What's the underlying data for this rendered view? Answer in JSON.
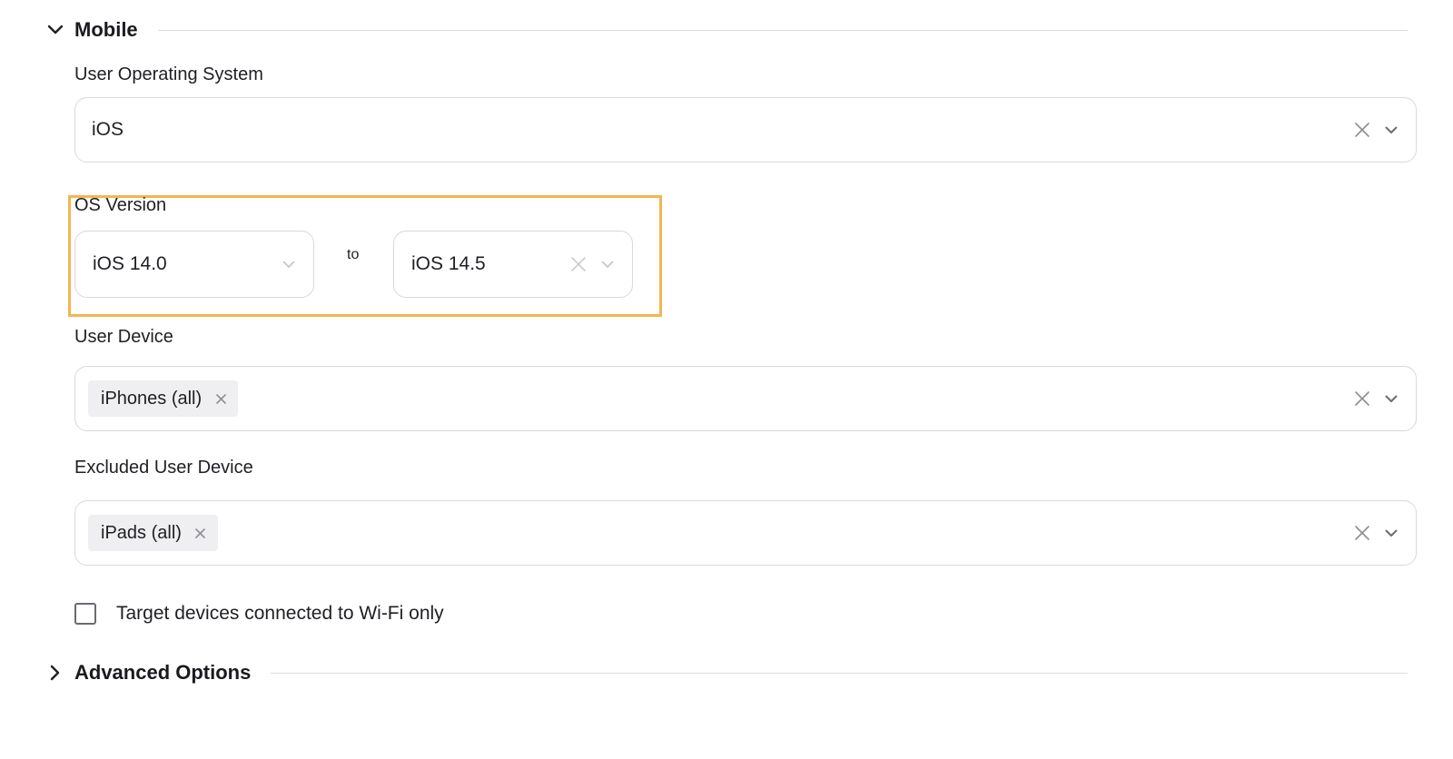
{
  "sections": {
    "mobile": {
      "title": "Mobile",
      "expanded": true,
      "icon": "chevron-down-icon"
    },
    "advanced": {
      "title": "Advanced Options",
      "expanded": false,
      "icon": "chevron-right-icon"
    }
  },
  "fields": {
    "os": {
      "label": "User Operating System",
      "value": "iOS",
      "clear_icon": "close-icon",
      "dropdown_icon": "chevron-down-icon"
    },
    "os_version": {
      "label": "OS Version",
      "from": {
        "value": "iOS 14.0",
        "dropdown_icon": "chevron-down-icon"
      },
      "separator": "to",
      "to": {
        "value": "iOS 14.5",
        "clear_icon": "close-icon",
        "dropdown_icon": "chevron-down-icon"
      },
      "highlight_color": "#f2b650"
    },
    "user_device": {
      "label": "User Device",
      "tags": [
        {
          "label": "iPhones (all)"
        }
      ],
      "clear_icon": "close-icon",
      "dropdown_icon": "chevron-down-icon"
    },
    "excluded_device": {
      "label": "Excluded User Device",
      "tags": [
        {
          "label": "iPads (all)"
        }
      ],
      "clear_icon": "close-icon",
      "dropdown_icon": "chevron-down-icon"
    },
    "wifi_only": {
      "label": "Target devices connected to Wi-Fi only",
      "checked": false
    }
  }
}
